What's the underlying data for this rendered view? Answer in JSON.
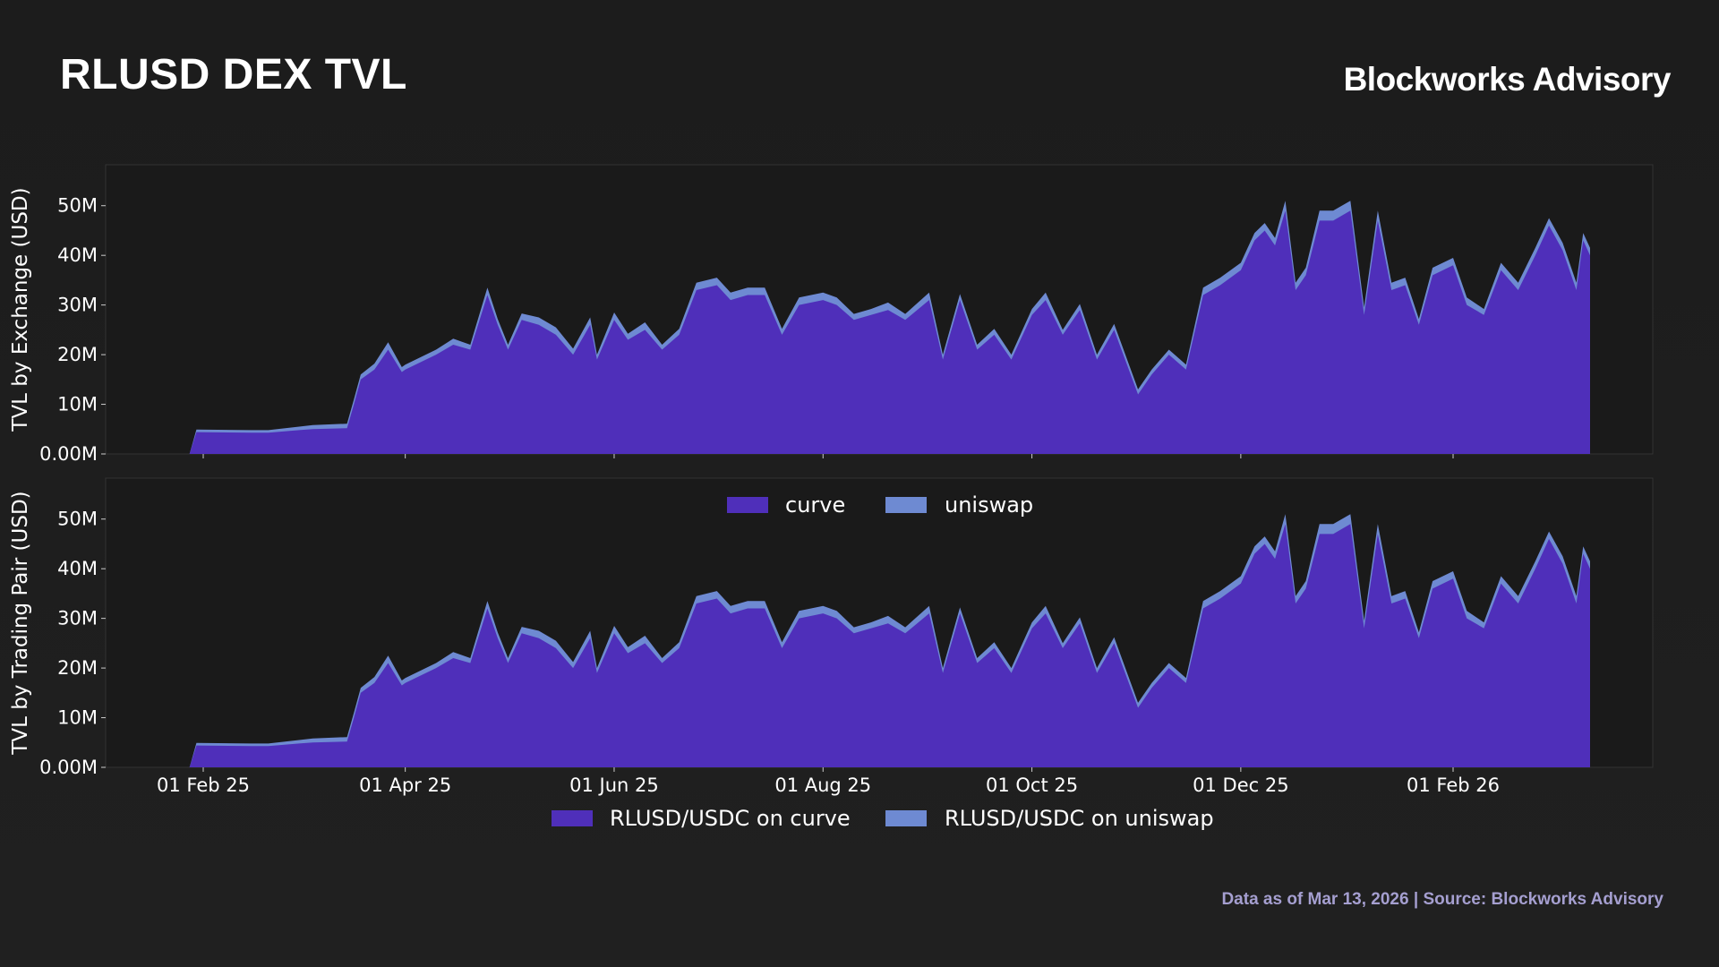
{
  "header": {
    "title": "RLUSD DEX TVL",
    "brand": "Blockworks Advisory"
  },
  "footer": {
    "note": "Data as of Mar 13, 2026 | Source: Blockworks Advisory"
  },
  "colors": {
    "background": "#1c1c1c",
    "curve": "#4f2fba",
    "uniswap": "#6e8ad2",
    "panel_border": "#3a3a3a",
    "footnote": "#a59fd0"
  },
  "chart_data": [
    {
      "type": "area",
      "stacked": true,
      "ylabel": "TVL by Exchange (USD)",
      "ylim": [
        0,
        55
      ],
      "yticks": [
        0,
        10,
        20,
        30,
        40,
        50
      ],
      "ytick_labels": [
        "0.00M",
        "10M",
        "20M",
        "30M",
        "40M",
        "50M"
      ],
      "xticks": [
        "2025-02-01",
        "2025-04-01",
        "2025-06-01",
        "2025-08-01",
        "2025-10-01",
        "2025-12-01",
        "2026-02-01"
      ],
      "xtick_labels": [
        "01 Feb 25",
        "01 Apr 25",
        "01 Jun 25",
        "01 Aug 25",
        "01 Oct 25",
        "01 Dec 25",
        "01 Feb 26"
      ],
      "show_xtick_labels": false,
      "legend": "bottom-center-inside",
      "x": [
        "2025-01-28",
        "2025-01-30",
        "2025-02-15",
        "2025-02-20",
        "2025-03-01",
        "2025-03-05",
        "2025-03-15",
        "2025-03-17",
        "2025-03-19",
        "2025-03-23",
        "2025-03-27",
        "2025-03-31",
        "2025-04-01",
        "2025-04-10",
        "2025-04-15",
        "2025-04-20",
        "2025-04-25",
        "2025-04-28",
        "2025-05-01",
        "2025-05-05",
        "2025-05-10",
        "2025-05-15",
        "2025-05-20",
        "2025-05-25",
        "2025-05-27",
        "2025-06-01",
        "2025-06-05",
        "2025-06-10",
        "2025-06-15",
        "2025-06-20",
        "2025-06-25",
        "2025-07-01",
        "2025-07-05",
        "2025-07-10",
        "2025-07-15",
        "2025-07-20",
        "2025-07-25",
        "2025-08-01",
        "2025-08-05",
        "2025-08-10",
        "2025-08-15",
        "2025-08-20",
        "2025-08-25",
        "2025-09-01",
        "2025-09-05",
        "2025-09-10",
        "2025-09-15",
        "2025-09-20",
        "2025-09-25",
        "2025-10-01",
        "2025-10-05",
        "2025-10-10",
        "2025-10-15",
        "2025-10-20",
        "2025-10-25",
        "2025-11-01",
        "2025-11-05",
        "2025-11-10",
        "2025-11-15",
        "2025-11-20",
        "2025-11-25",
        "2025-12-01",
        "2025-12-05",
        "2025-12-08",
        "2025-12-11",
        "2025-12-14",
        "2025-12-17",
        "2025-12-20",
        "2025-12-24",
        "2025-12-28",
        "2026-01-02",
        "2026-01-06",
        "2026-01-10",
        "2026-01-14",
        "2026-01-18",
        "2026-01-22",
        "2026-01-26",
        "2026-02-01",
        "2026-02-05",
        "2026-02-10",
        "2026-02-15",
        "2026-02-20",
        "2026-02-25",
        "2026-03-01",
        "2026-03-05",
        "2026-03-09",
        "2026-03-11",
        "2026-03-13"
      ],
      "series": [
        {
          "name": "curve",
          "values": [
            0,
            4.4,
            4.3,
            4.3,
            4.8,
            5.0,
            5.2,
            10,
            15,
            17,
            21,
            16.5,
            17,
            20,
            22,
            21,
            32,
            26,
            21,
            27,
            26,
            24,
            20,
            26,
            19,
            27,
            23,
            25,
            21,
            24,
            33,
            34,
            31,
            32,
            32,
            24,
            30,
            31,
            30,
            27,
            28,
            29,
            27,
            31,
            19,
            31,
            21,
            24,
            19,
            28,
            31,
            24,
            29,
            19,
            25,
            12,
            16,
            20,
            17,
            32,
            34,
            37,
            43,
            45,
            42,
            49,
            33,
            36,
            47,
            47,
            49,
            28,
            47,
            33,
            34,
            26,
            36,
            38,
            30,
            28,
            37,
            33,
            40,
            46,
            41,
            33,
            43,
            40
          ]
        },
        {
          "name": "uniswap",
          "values": [
            0,
            0.5,
            0.5,
            0.5,
            0.7,
            0.8,
            0.9,
            1.0,
            1.0,
            1.2,
            1.5,
            1.0,
            1.0,
            1.0,
            1.2,
            1.0,
            1.5,
            1.2,
            1.0,
            1.3,
            1.5,
            1.5,
            1.2,
            1.5,
            1.0,
            1.5,
            1.2,
            1.5,
            1.0,
            1.2,
            1.5,
            1.5,
            1.5,
            1.5,
            1.5,
            1.2,
            1.5,
            1.5,
            1.5,
            1.2,
            1.2,
            1.5,
            1.2,
            1.5,
            1.0,
            1.2,
            1.0,
            1.2,
            1.0,
            1.2,
            1.5,
            1.0,
            1.2,
            1.0,
            1.2,
            1.0,
            1.0,
            1.0,
            1.0,
            1.5,
            1.5,
            1.5,
            1.5,
            1.5,
            1.5,
            2.0,
            1.5,
            1.5,
            2.0,
            2.0,
            2.0,
            1.5,
            2.0,
            1.5,
            1.5,
            1.2,
            1.5,
            1.5,
            1.5,
            1.2,
            1.5,
            1.5,
            1.5,
            1.5,
            1.5,
            1.5,
            1.5,
            1.5
          ]
        }
      ]
    },
    {
      "type": "area",
      "stacked": true,
      "ylabel": "TVL by Trading Pair (USD)",
      "ylim": [
        0,
        55
      ],
      "yticks": [
        0,
        10,
        20,
        30,
        40,
        50
      ],
      "ytick_labels": [
        "0.00M",
        "10M",
        "20M",
        "30M",
        "40M",
        "50M"
      ],
      "xticks": [
        "2025-02-01",
        "2025-04-01",
        "2025-06-01",
        "2025-08-01",
        "2025-10-01",
        "2025-12-01",
        "2026-02-01"
      ],
      "xtick_labels": [
        "01 Feb 25",
        "01 Apr 25",
        "01 Jun 25",
        "01 Aug 25",
        "01 Oct 25",
        "01 Dec 25",
        "01 Feb 26"
      ],
      "show_xtick_labels": true,
      "legend": "bottom-center-outside",
      "same_x_as": 0,
      "series": [
        {
          "name": "RLUSD/USDC on curve",
          "same_values_as": "curve"
        },
        {
          "name": "RLUSD/USDC on uniswap",
          "same_values_as": "uniswap"
        }
      ]
    }
  ]
}
